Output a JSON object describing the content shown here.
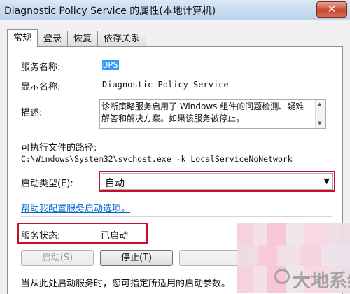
{
  "window": {
    "title": "Diagnostic Policy Service 的属性(本地计算机)",
    "close_label": "✕"
  },
  "tabs": [
    {
      "label": "常规",
      "active": true
    },
    {
      "label": "登录",
      "active": false
    },
    {
      "label": "恢复",
      "active": false
    },
    {
      "label": "依存关系",
      "active": false
    }
  ],
  "general": {
    "service_name_label": "服务名称:",
    "service_name_value": "DPS",
    "display_name_label": "显示名称:",
    "display_name_value": "Diagnostic Policy Service",
    "description_label": "描述:",
    "description_value": "诊断策略服务启用了 Windows 组件的问题检测、疑难解答和解决方案。如果该服务被停止，",
    "exe_path_label": "可执行文件的路径:",
    "exe_path_value": "C:\\Windows\\System32\\svchost.exe -k LocalServiceNoNetwork",
    "startup_type_label": "启动类型(E):",
    "startup_type_value": "自动",
    "help_link": "帮助我配置服务启动选项。",
    "service_status_label": "服务状态:",
    "service_status_value": "已启动",
    "start_button": "启动(S)",
    "stop_button": "停止(T)",
    "pause_button": "",
    "bottom_text": "当从此处启动服务时，您可指定所适用的启动参数。"
  },
  "watermark": {
    "text": "大地系统"
  },
  "colors": {
    "highlight_box": "#c8102e",
    "link": "#0066cc",
    "selection": "#3399ff"
  }
}
